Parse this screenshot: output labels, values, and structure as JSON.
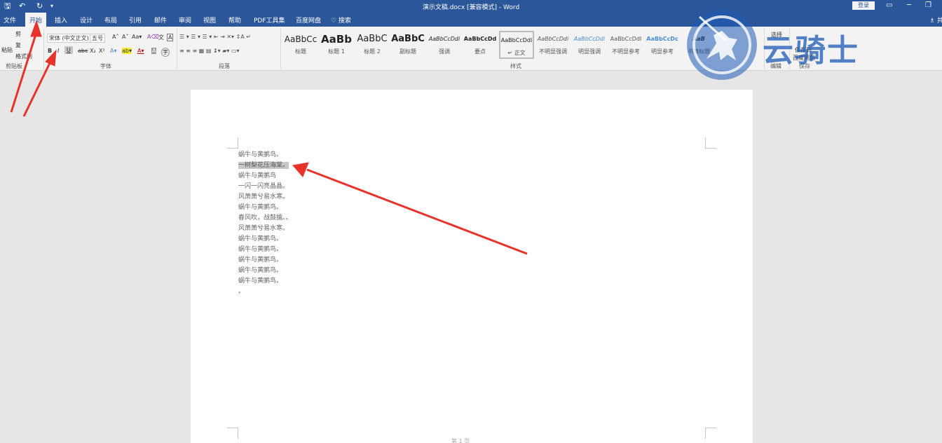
{
  "titlebar": {
    "title": "演示文稿.docx [兼容模式] - Word",
    "login_label": "登录",
    "qa_save": "🖫",
    "qa_undo": "↶",
    "qa_redo": "↻",
    "qa_more": "▾",
    "win_ribbon": "▭",
    "win_min": "─",
    "win_restore": "❐"
  },
  "tabs": {
    "file": "文件",
    "home": "开始",
    "insert": "插入",
    "design": "设计",
    "layout": "布局",
    "references": "引用",
    "mailings": "邮件",
    "review": "审阅",
    "view": "视图",
    "help": "帮助",
    "pdf": "PDF工具集",
    "baidu": "百度网盘",
    "search": "♡ 搜索",
    "share": "♗ 共"
  },
  "ribbon": {
    "clipboard": {
      "paste": "粘贴",
      "cut": "剪",
      "copy": "复",
      "painter": "格式刷",
      "label": "剪贴板"
    },
    "font": {
      "name": "宋体 (中文正文)",
      "size": "五号",
      "grow": "A˄",
      "shrink": "A˅",
      "case": "Aa▾",
      "clear": "A⌫",
      "phonetic": "文",
      "border": "A",
      "bold": "B",
      "italic": "I",
      "underline": "U",
      "strike": "abc",
      "sub": "X₂",
      "sup": "X²",
      "effects": "A▾",
      "highlight": "ab▾",
      "color": "A▾",
      "shade": "A",
      "enclose": "字",
      "label": "字体"
    },
    "paragraph": {
      "label": "段落",
      "row1": "☰ ▾  ☰ ▾  ☰ ▾  ⇤ ⇥  ✕▾  ↕A  ↵",
      "row2": "≡ ≡ ≡ ▦ ▤  ↨▾  ▰▾  ▭▾"
    },
    "styles": {
      "label": "样式",
      "items": [
        {
          "sample": "AaBbCc",
          "name": "标题"
        },
        {
          "sample": "AaBb",
          "name": "标题 1"
        },
        {
          "sample": "AaBbC",
          "name": "标题 2"
        },
        {
          "sample": "AaBbC",
          "name": "副标题"
        },
        {
          "sample": "AaBbCcDdi",
          "name": "强调"
        },
        {
          "sample": "AaBbCcDd",
          "name": "要点"
        },
        {
          "sample": "AaBbCcDdl",
          "name": "↵ 正文"
        },
        {
          "sample": "AaBbCcDdi",
          "name": "不明显强调"
        },
        {
          "sample": "AaBbCcDdi",
          "name": "明显强调"
        },
        {
          "sample": "AaBbCcDdI",
          "name": "不明显参考"
        },
        {
          "sample": "AaBbCcDc",
          "name": "明显参考"
        },
        {
          "sample": "AaB",
          "name": "书籍标题"
        }
      ]
    },
    "editing": {
      "label": "编辑",
      "item": "选择"
    },
    "save": {
      "label": "保存",
      "item1": "保存到",
      "item2": "百度网盘"
    }
  },
  "watermark": {
    "text": "云骑士"
  },
  "document": {
    "lines": [
      "蜗牛与黄鹂鸟。",
      "一树梨花压海棠。",
      "蜗牛与黄鹂鸟",
      "一闪一闪亮晶晶。",
      "风萧萧兮易水寒。",
      "蜗牛与黄鹂鸟。",
      "春风吹，战鼓擂。。",
      "风萧萧兮易水寒。",
      "蜗牛与黄鹂鸟。",
      "蜗牛与黄鹂鸟。",
      "蜗牛与黄鹂鸟。",
      "蜗牛与黄鹂鸟。",
      "蜗牛与黄鹂鸟。",
      "。"
    ],
    "selected_line_index": 1,
    "footer": "第 1 页"
  },
  "colors": {
    "word_blue": "#2b579a",
    "ribbon_bg": "#f3f3f3",
    "annotation_red": "#e8332b",
    "selection": "#c8c8c8"
  }
}
